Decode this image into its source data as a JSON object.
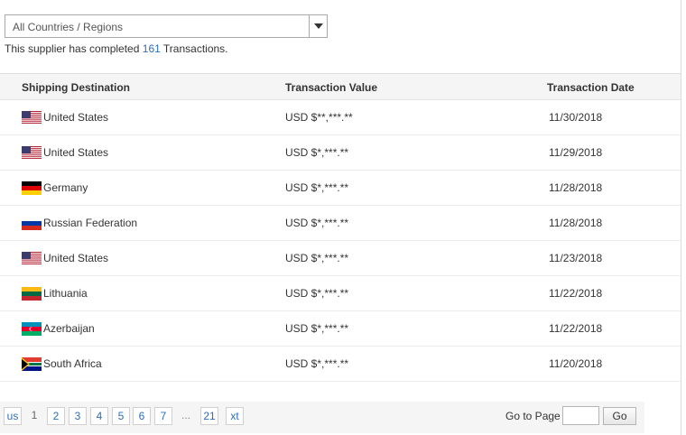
{
  "filter": {
    "selected": "All Countries / Regions"
  },
  "summary": {
    "prefix": "This supplier has completed",
    "count": "161",
    "suffix": "Transactions."
  },
  "table": {
    "headers": {
      "destination": "Shipping Destination",
      "value": "Transaction Value",
      "date": "Transaction Date"
    },
    "rows": [
      {
        "country": "United States",
        "flag": "us",
        "value": "USD $**,***.**",
        "date": "11/30/2018"
      },
      {
        "country": "United States",
        "flag": "us",
        "value": "USD $*,***.**",
        "date": "11/29/2018"
      },
      {
        "country": "Germany",
        "flag": "de",
        "value": "USD $*,***.**",
        "date": "11/28/2018"
      },
      {
        "country": "Russian Federation",
        "flag": "ru",
        "value": "USD $*,***.**",
        "date": "11/28/2018"
      },
      {
        "country": "United States",
        "flag": "us",
        "value": "USD $*,***.**",
        "date": "11/23/2018"
      },
      {
        "country": "Lithuania",
        "flag": "lt",
        "value": "USD $*,***.**",
        "date": "11/22/2018"
      },
      {
        "country": "Azerbaijan",
        "flag": "az",
        "value": "USD $*,***.**",
        "date": "11/22/2018"
      },
      {
        "country": "South Africa",
        "flag": "za",
        "value": "USD $*,***.**",
        "date": "11/20/2018"
      }
    ]
  },
  "pagination": {
    "prev_label": "us",
    "current": "1",
    "pages": [
      "2",
      "3",
      "4",
      "5",
      "6",
      "7"
    ],
    "ellipsis": "...",
    "last": "21",
    "next_label": "xt",
    "goto_label": "Go to Page",
    "goto_value": "",
    "go_label": "Go"
  }
}
